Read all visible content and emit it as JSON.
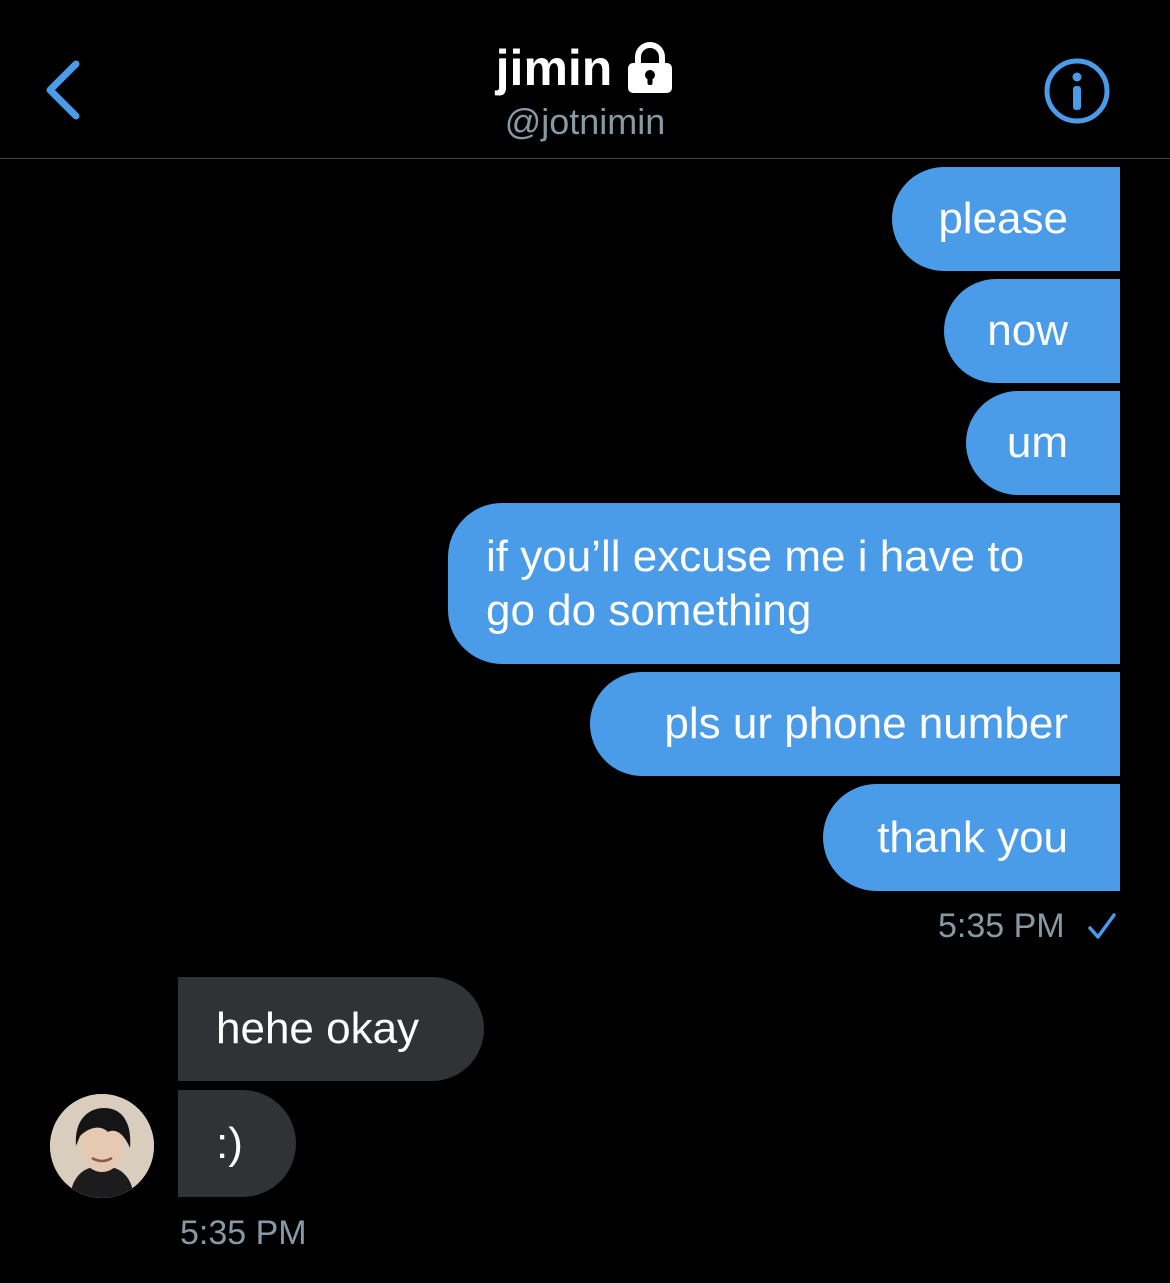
{
  "header": {
    "name": "jimin",
    "handle": "@jotnimin",
    "back_icon": "chevron-left-icon",
    "lock_icon": "lock-icon",
    "info_icon": "info-icon"
  },
  "messages_out": [
    "please",
    "now",
    "um",
    "if you’ll excuse me i have to",
    "go do something",
    "pls ur phone number",
    "thank you"
  ],
  "sent_time": "5:35 PM",
  "messages_in": [
    "hehe okay",
    ":)"
  ],
  "received_time": "5:35 PM",
  "colors": {
    "background": "#000000",
    "accent": "#4a9be8",
    "incoming_bubble": "#2f3336",
    "muted_text": "#8899a6"
  }
}
